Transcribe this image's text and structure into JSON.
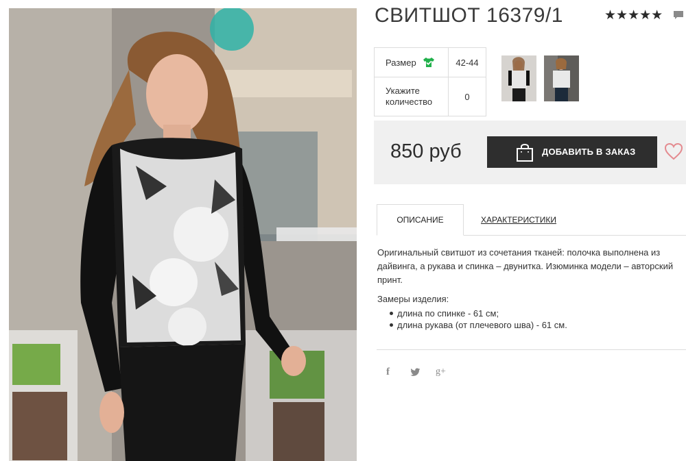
{
  "product": {
    "title": "СВИТШОТ 16379/1",
    "rating_stars": "★★★★★"
  },
  "options": {
    "size_label": "Размер",
    "size_value": "42-44",
    "qty_label": "Укажите количество",
    "qty_value": "0"
  },
  "buy": {
    "price": "850 руб",
    "add_button_label": "ДОБАВИТЬ В ЗАКАЗ"
  },
  "tabs": [
    {
      "label": "ОПИСАНИЕ"
    },
    {
      "label": "ХАРАКТЕРИСТИКИ"
    }
  ],
  "description": {
    "text": "Оригинальный свитшот из сочетания тканей: полочка выполнена из дайвинга, а рукава и спинка – двунитка. Изюминка модели – авторский принт.",
    "measures_title": "Замеры изделия:",
    "measures": [
      "длина по спинке - 61 см;",
      "длина рукава (от плечевого шва) - 61 см."
    ]
  },
  "social": {
    "facebook": "f",
    "googleplus": "g+"
  },
  "colors": {
    "accent_green": "#21b04b",
    "button_dark": "#2e2e2e",
    "heart_pink": "#e48a8f",
    "panel_grey": "#f0f0f0"
  },
  "icons": [
    "shirt-check-icon",
    "comment-icon",
    "shopping-bag-icon",
    "heart-icon",
    "facebook-icon",
    "twitter-icon",
    "google-plus-icon"
  ]
}
